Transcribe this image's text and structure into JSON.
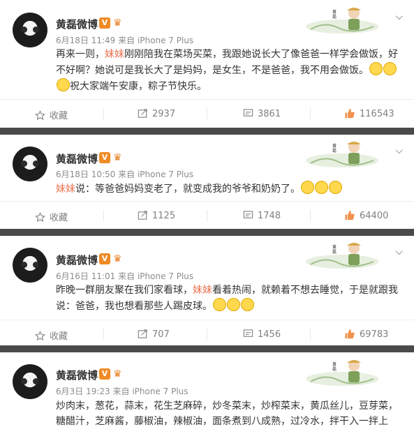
{
  "posts": [
    {
      "name": "黄磊微博",
      "card_name": "黄磊",
      "time": "6月18日 11:49",
      "source": "来自 iPhone 7 Plus",
      "segments": [
        {
          "text": "再来一则，",
          "hl": false
        },
        {
          "text": "妹妹",
          "hl": true
        },
        {
          "text": "刚刚陪我在菜场买菜，我跟她说长大了像爸爸一样学会做饭，好不好啊？她说可是我长大了是妈妈，是女生，不是爸爸，我不用会做饭。",
          "hl": false
        },
        {
          "emoji": 2
        },
        {
          "br": true
        },
        {
          "emoji": 1
        },
        {
          "text": "祝大家端午安康，粽子节快乐。",
          "hl": false
        }
      ],
      "actions": {
        "favorite": "收藏",
        "repost": "2937",
        "comment": "3861",
        "like": "116543"
      }
    },
    {
      "name": "黄磊微博",
      "card_name": "黄磊",
      "time": "6月18日 10:50",
      "source": "来自 iPhone 7 Plus",
      "segments": [
        {
          "text": "妹妹",
          "hl": true
        },
        {
          "text": "说：等爸爸妈妈变老了，就变成我的爷爷和奶奶了。",
          "hl": false
        },
        {
          "emoji": 3
        }
      ],
      "actions": {
        "favorite": "收藏",
        "repost": "1125",
        "comment": "1748",
        "like": "64400"
      }
    },
    {
      "name": "黄磊微博",
      "card_name": "黄磊",
      "time": "6月16日 11:01",
      "source": "来自 iPhone 7 Plus",
      "segments": [
        {
          "text": "昨晚一群朋友聚在我们家看球，",
          "hl": false
        },
        {
          "text": "妹妹",
          "hl": true
        },
        {
          "text": "看着热闹，就赖着不想去睡觉，于是就跟我说：爸爸，我也想看那些人踢皮球。",
          "hl": false
        },
        {
          "emoji": 3
        }
      ],
      "actions": {
        "favorite": "收藏",
        "repost": "707",
        "comment": "1456",
        "like": "69783"
      }
    },
    {
      "name": "黄磊微博",
      "card_name": "黄磊",
      "time": "6月3日 19:23",
      "source": "来自 iPhone 7 Plus",
      "segments": [
        {
          "text": "炒肉末，葱花，蒜末，花生芝麻碎，炒冬菜末，炒榨菜末，黄瓜丝儿，豆芽菜，糖醋汁，芝麻酱，藤椒油，辣椒油，面条煮到八成熟，过冷水，拌干入一拌上",
          "hl": false
        }
      ],
      "actions": null
    }
  ],
  "colors": {
    "highlight": "#eb7350",
    "separator": "#4a4a4a",
    "muted": "#8c8c8c",
    "like_icon": "#f0914d",
    "v_badge": "#f08a24"
  },
  "icons": {
    "favorite": "star-icon",
    "repost": "repost-icon",
    "comment": "comment-icon",
    "like": "thumbs-up-icon",
    "more": "chevron-down-icon"
  }
}
